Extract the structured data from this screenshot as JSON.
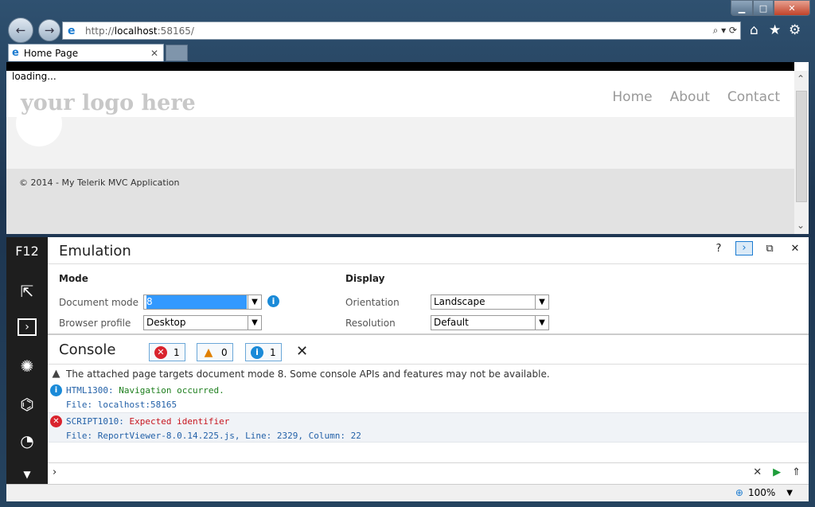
{
  "browser": {
    "url_prefix": "http://",
    "url_host": "localhost",
    "url_rest": ":58165/",
    "tab_title": "Home Page",
    "zoom": "100%"
  },
  "page": {
    "loading_text": "loading...",
    "logo_text": "your logo here",
    "nav": [
      "Home",
      "About",
      "Contact"
    ],
    "footer_text": "© 2014 - My Telerik MVC Application"
  },
  "devtools": {
    "f12_label": "F12",
    "emulation": {
      "title": "Emulation",
      "mode_heading": "Mode",
      "display_heading": "Display",
      "document_mode_label": "Document mode",
      "document_mode_value": "8",
      "browser_profile_label": "Browser profile",
      "browser_profile_value": "Desktop",
      "orientation_label": "Orientation",
      "orientation_value": "Landscape",
      "resolution_label": "Resolution",
      "resolution_value": "Default"
    },
    "console": {
      "title": "Console",
      "error_count": "1",
      "warning_count": "0",
      "info_count": "1",
      "messages": {
        "warn_text": "The attached page targets document mode 8.  Some console APIs and features may not be available.",
        "nav_code": "HTML1300:",
        "nav_text": "Navigation occurred.",
        "nav_file": "File: localhost:58165",
        "err_code": "SCRIPT1010:",
        "err_text": "Expected identifier",
        "err_file": "File: ReportViewer-8.0.14.225.js, Line: 2329, Column: 22"
      }
    }
  }
}
